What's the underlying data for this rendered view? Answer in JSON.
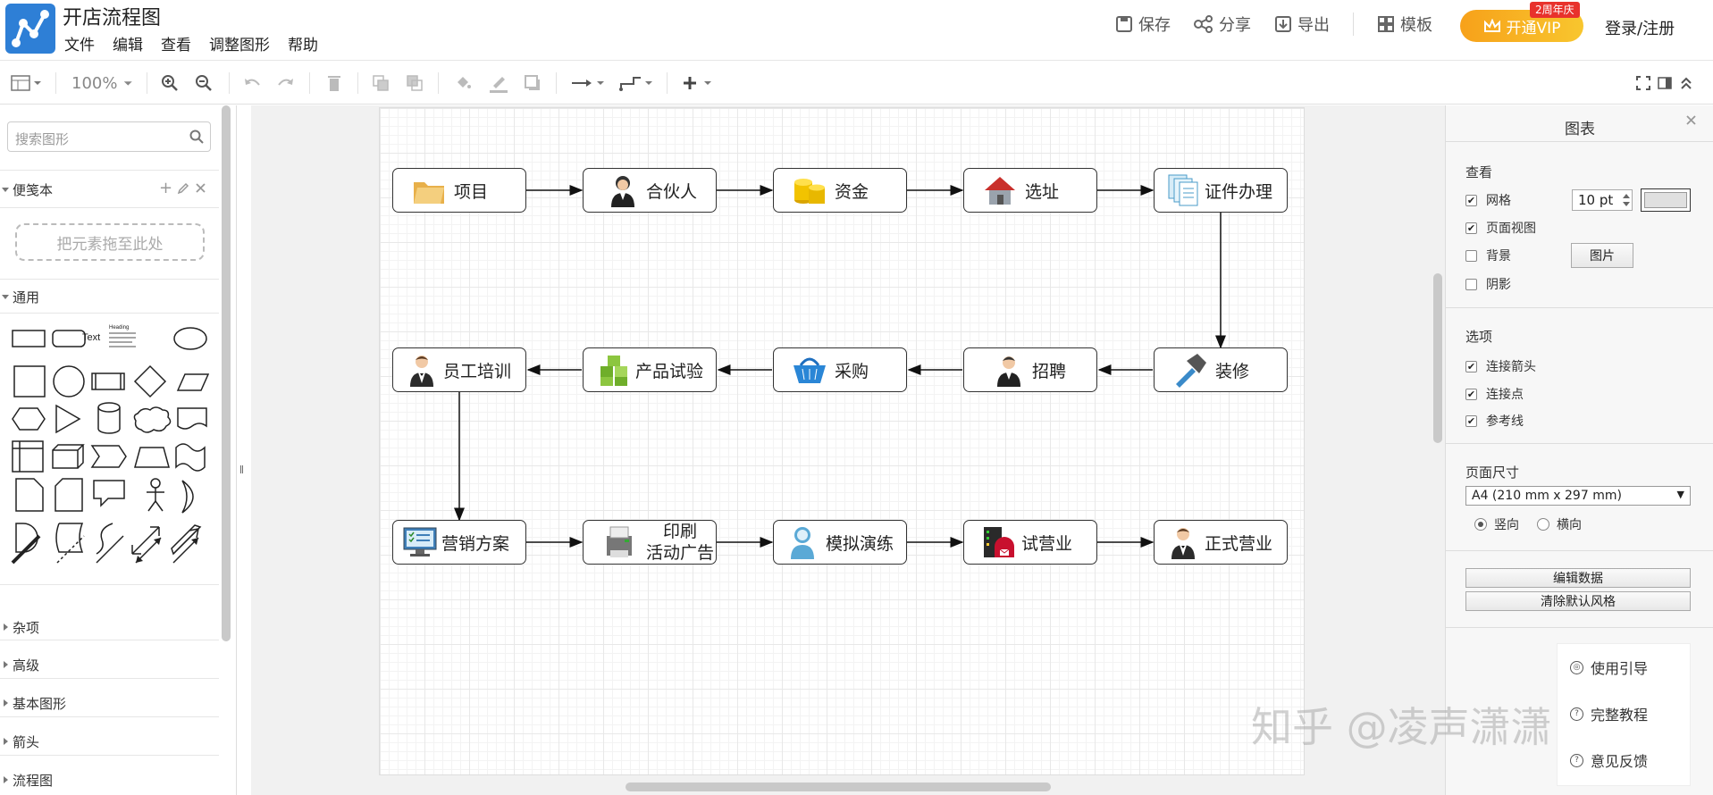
{
  "header": {
    "title": "开店流程图",
    "menu": [
      "文件",
      "编辑",
      "查看",
      "调整图形",
      "帮助"
    ],
    "actions": {
      "save": "保存",
      "share": "分享",
      "export": "导出",
      "template": "模板"
    },
    "vip": {
      "label": "开通VIP",
      "badge": "2周年庆"
    },
    "login": "登录/注册"
  },
  "toolbar": {
    "zoom": "100%"
  },
  "sidebar": {
    "search_placeholder": "搜索图形",
    "notebook": "便笺本",
    "drop_hint": "把元素拖至此处",
    "general": "通用",
    "shape_text": "Text",
    "shape_heading": "Heading",
    "sections": [
      "杂项",
      "高级",
      "基本图形",
      "箭头",
      "流程图"
    ]
  },
  "diagram": {
    "nodes": [
      {
        "id": "n1",
        "label": "项目",
        "icon": "folder-icon"
      },
      {
        "id": "n2",
        "label": "合伙人",
        "icon": "person-icon"
      },
      {
        "id": "n3",
        "label": "资金",
        "icon": "coins-icon"
      },
      {
        "id": "n4",
        "label": "选址",
        "icon": "house-icon"
      },
      {
        "id": "n5",
        "label": "证件办理",
        "icon": "documents-icon"
      },
      {
        "id": "n6",
        "label": "装修",
        "icon": "hammer-icon"
      },
      {
        "id": "n7",
        "label": "招聘",
        "icon": "person-icon"
      },
      {
        "id": "n8",
        "label": "采购",
        "icon": "basket-icon"
      },
      {
        "id": "n9",
        "label": "产品试验",
        "icon": "cubes-icon"
      },
      {
        "id": "n10",
        "label": "员工培训",
        "icon": "waiter-icon"
      },
      {
        "id": "n11",
        "label": "营销方案",
        "icon": "monitor-icon"
      },
      {
        "id": "n12",
        "label_line1": "印刷",
        "label_line2": "活动广告",
        "icon": "printer-icon"
      },
      {
        "id": "n13",
        "label": "模拟演练",
        "icon": "user-icon"
      },
      {
        "id": "n14",
        "label": "试营业",
        "icon": "server-icon"
      },
      {
        "id": "n15",
        "label": "正式营业",
        "icon": "waiter-icon"
      }
    ]
  },
  "right_panel": {
    "title": "图表",
    "view_heading": "查看",
    "grid": "网格",
    "grid_size": "10 pt",
    "page_view": "页面视图",
    "background": "背景",
    "image_button": "图片",
    "shadow": "阴影",
    "options_heading": "选项",
    "connect_arrows": "连接箭头",
    "connection_points": "连接点",
    "guides": "参考线",
    "page_size_heading": "页面尺寸",
    "page_size": "A4 (210 mm x 297 mm)",
    "portrait": "竖向",
    "landscape": "横向",
    "edit_data": "编辑数据",
    "clear_style": "清除默认风格",
    "help": {
      "guide": "使用引导",
      "tutorial": "完整教程",
      "feedback": "意见反馈"
    },
    "colors": {
      "grid_color": "#e0e0e0"
    }
  },
  "watermark": "知乎 @凌声潇潇"
}
